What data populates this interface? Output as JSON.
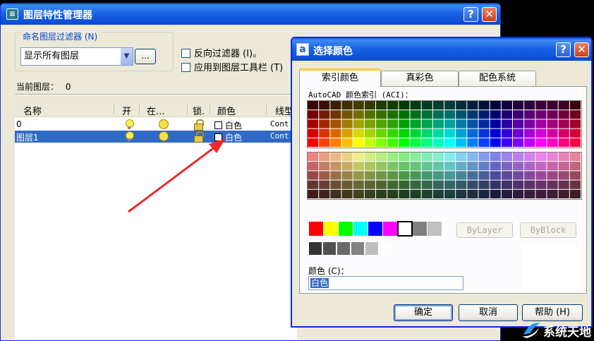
{
  "layer_manager": {
    "title": "图层特性管理器",
    "help_btn": "?",
    "close_btn": "✕",
    "filter_group_label": "命名图层过滤器 (N)",
    "filter_value": "显示所有图层",
    "filter_more": "...",
    "invert_filter": "反向过滤器 (I)。",
    "apply_toolbar": "应用到图层工具栏 (T)",
    "current_layer_label": "当前图层：",
    "current_layer_value": "0",
    "columns": [
      "名称",
      "开",
      "在...",
      "锁.",
      "颜色",
      "线型"
    ],
    "rows": [
      {
        "name": "0",
        "color": "白色",
        "linetype": "Cont",
        "selected": false
      },
      {
        "name": "图层1",
        "color": "白色",
        "linetype": "Cont",
        "selected": true
      }
    ]
  },
  "color_dialog": {
    "title": "选择颜色",
    "help_btn": "?",
    "close_btn": "✕",
    "tabs": [
      "索引颜色",
      "真彩色",
      "配色系统"
    ],
    "active_tab": 0,
    "aci_label": "AutoCAD 颜色索引 (ACI)：",
    "bylayer": "ByLayer",
    "byblock": "ByBlock",
    "color_label": "颜色 (C)：",
    "color_value": "白色",
    "ok": "确定",
    "cancel": "取消",
    "help": "帮助 (H)",
    "standard_colors": [
      "#ff0000",
      "#ffff00",
      "#00ff00",
      "#00ffff",
      "#0000ff",
      "#ff00ff",
      "#ffffff",
      "#808080",
      "#c0c0c0"
    ],
    "gray_colors": [
      "#333333",
      "#505050",
      "#696969",
      "#828282",
      "#bebebe",
      "#ffffff"
    ]
  },
  "watermark": {
    "text": "系统天地"
  }
}
